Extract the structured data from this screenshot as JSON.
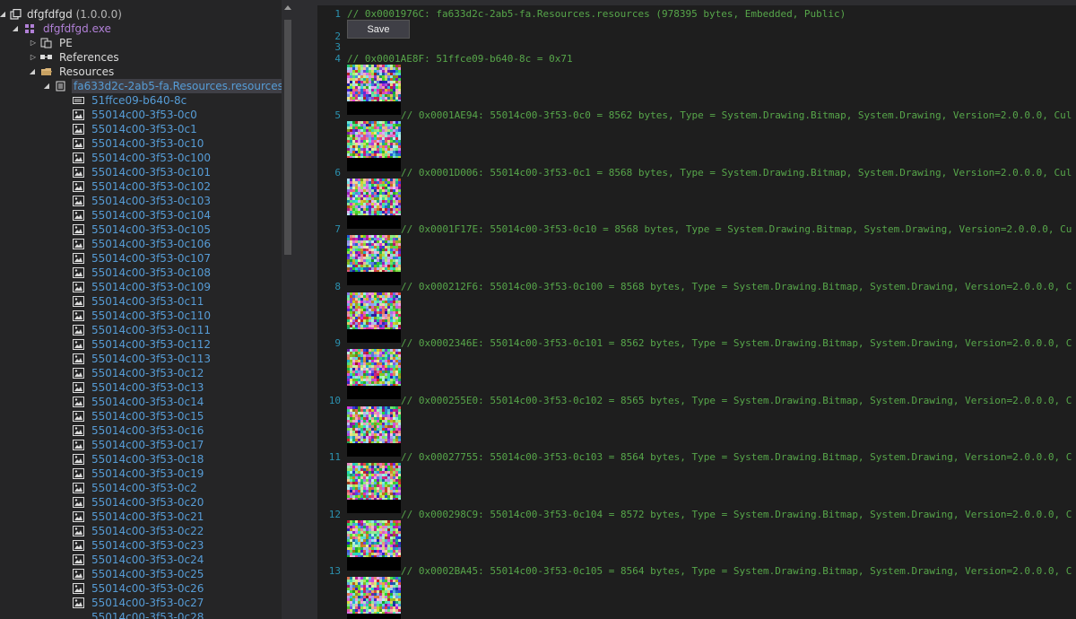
{
  "tree": {
    "root": {
      "label": "dfgfdfgd",
      "version": "(1.0.0.0)"
    },
    "exe": "dfgfdfgd.exe",
    "pe": "PE",
    "references": "References",
    "resources": "Resources",
    "resource_file": "fa633d2c-2ab5-fa.Resources.resources",
    "items": [
      "51ffce09-b640-8c",
      "55014c00-3f53-0c0",
      "55014c00-3f53-0c1",
      "55014c00-3f53-0c10",
      "55014c00-3f53-0c100",
      "55014c00-3f53-0c101",
      "55014c00-3f53-0c102",
      "55014c00-3f53-0c103",
      "55014c00-3f53-0c104",
      "55014c00-3f53-0c105",
      "55014c00-3f53-0c106",
      "55014c00-3f53-0c107",
      "55014c00-3f53-0c108",
      "55014c00-3f53-0c109",
      "55014c00-3f53-0c11",
      "55014c00-3f53-0c110",
      "55014c00-3f53-0c111",
      "55014c00-3f53-0c112",
      "55014c00-3f53-0c113",
      "55014c00-3f53-0c12",
      "55014c00-3f53-0c13",
      "55014c00-3f53-0c14",
      "55014c00-3f53-0c15",
      "55014c00-3f53-0c16",
      "55014c00-3f53-0c17",
      "55014c00-3f53-0c18",
      "55014c00-3f53-0c19",
      "55014c00-3f53-0c2",
      "55014c00-3f53-0c20",
      "55014c00-3f53-0c21",
      "55014c00-3f53-0c22",
      "55014c00-3f53-0c23",
      "55014c00-3f53-0c24",
      "55014c00-3f53-0c25",
      "55014c00-3f53-0c26",
      "55014c00-3f53-0c27"
    ]
  },
  "editor": {
    "save_label": "Save",
    "lines": [
      {
        "num": "1",
        "text": "// 0x0001976C: fa633d2c-2ab5-fa.Resources.resources (978395 bytes, Embedded, Public)"
      },
      {
        "num": "2",
        "text": ""
      },
      {
        "num": "3",
        "text": ""
      },
      {
        "num": "4",
        "text": "// 0x0001AE8F: 51ffce09-b640-8c = 0x71"
      },
      {
        "num": "5",
        "text": "// 0x0001AE94: 55014c00-3f53-0c0 = 8562 bytes, Type = System.Drawing.Bitmap, System.Drawing, Version=2.0.0.0, Cul"
      },
      {
        "num": "6",
        "text": "// 0x0001D006: 55014c00-3f53-0c1 = 8568 bytes, Type = System.Drawing.Bitmap, System.Drawing, Version=2.0.0.0, Cul"
      },
      {
        "num": "7",
        "text": "// 0x0001F17E: 55014c00-3f53-0c10 = 8568 bytes, Type = System.Drawing.Bitmap, System.Drawing, Version=2.0.0.0, Cu"
      },
      {
        "num": "8",
        "text": "// 0x000212F6: 55014c00-3f53-0c100 = 8568 bytes, Type = System.Drawing.Bitmap, System.Drawing, Version=2.0.0.0, C"
      },
      {
        "num": "9",
        "text": "// 0x0002346E: 55014c00-3f53-0c101 = 8562 bytes, Type = System.Drawing.Bitmap, System.Drawing, Version=2.0.0.0, C"
      },
      {
        "num": "10",
        "text": "// 0x000255E0: 55014c00-3f53-0c102 = 8565 bytes, Type = System.Drawing.Bitmap, System.Drawing, Version=2.0.0.0, C"
      },
      {
        "num": "11",
        "text": "// 0x00027755: 55014c00-3f53-0c103 = 8564 bytes, Type = System.Drawing.Bitmap, System.Drawing, Version=2.0.0.0, C"
      },
      {
        "num": "12",
        "text": "// 0x000298C9: 55014c00-3f53-0c104 = 8572 bytes, Type = System.Drawing.Bitmap, System.Drawing, Version=2.0.0.0, C"
      },
      {
        "num": "13",
        "text": "// 0x0002BA45: 55014c00-3f53-0c105 = 8564 bytes, Type = System.Drawing.Bitmap, System.Drawing, Version=2.0.0.0, C"
      }
    ]
  },
  "colors": {
    "background": "#1e1e1e",
    "comment": "#57a64a",
    "line_number": "#2b91af",
    "tree_link": "#569cd6"
  },
  "icons": [
    "assembly-icon",
    "exe-icon",
    "pe-icon",
    "references-icon",
    "folder-icon",
    "resource-file-icon",
    "binary-icon",
    "image-icon"
  ]
}
